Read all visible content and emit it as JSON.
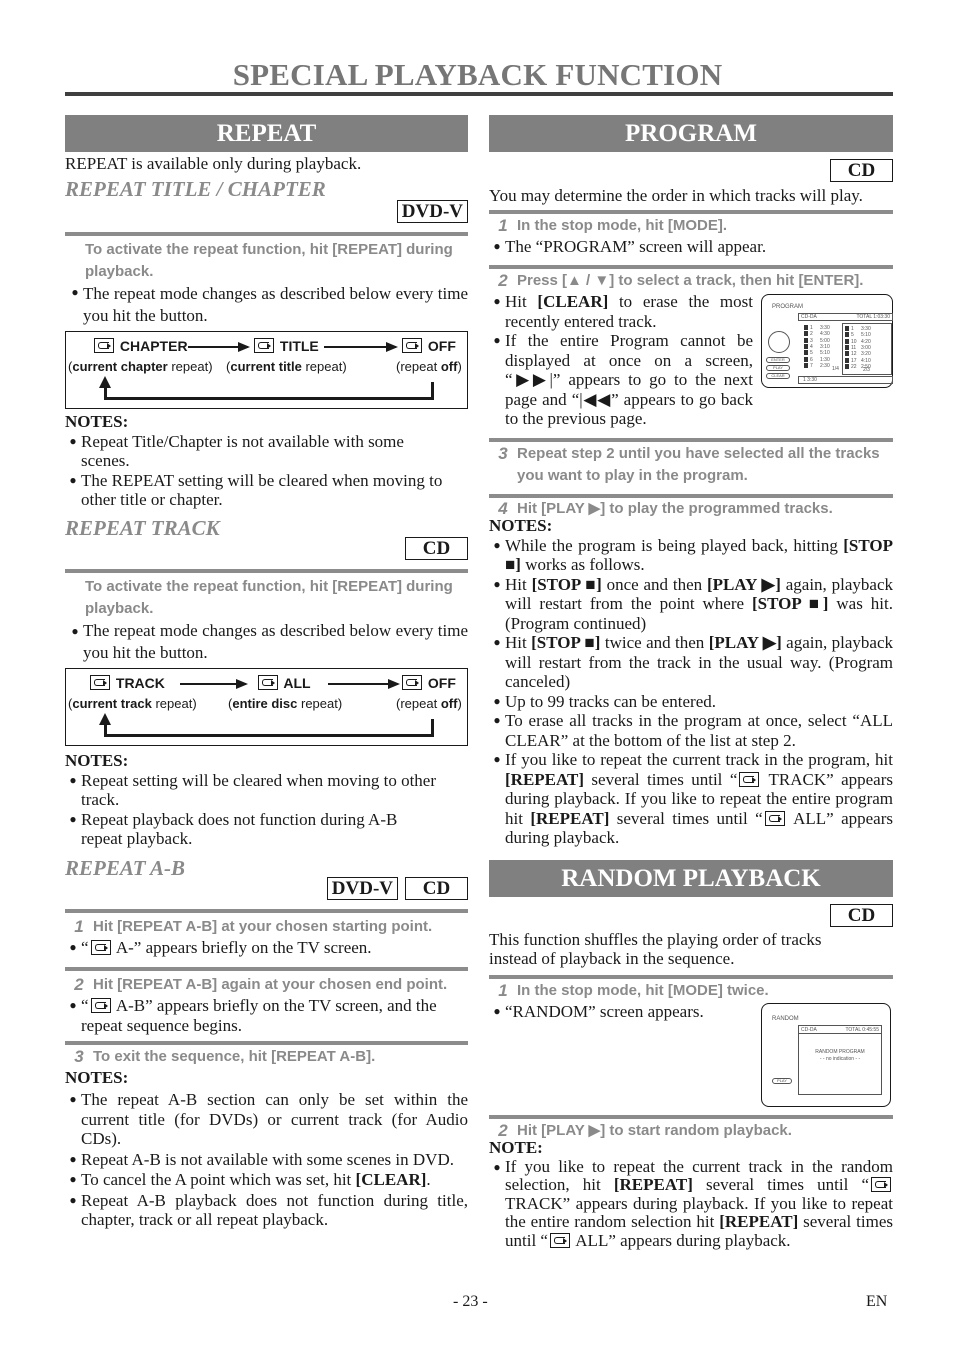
{
  "page": {
    "title": "SPECIAL PLAYBACK FUNCTION",
    "page_number": "- 23 -",
    "language": "EN"
  },
  "repeat": {
    "banner": "REPEAT",
    "intro": "REPEAT is available only during playback.",
    "title_chapter": {
      "heading": "REPEAT TITLE / CHAPTER",
      "tags": [
        "DVD-V"
      ],
      "instruction": "To activate the repeat function, hit [REPEAT] during playback.",
      "bullet": "The repeat mode changes as described below every time you hit the button.",
      "flow": [
        {
          "label": "CHAPTER",
          "caption_bold": "current chapter",
          "caption_rest": " repeat",
          "caption_prefix": ""
        },
        {
          "label": "TITLE",
          "caption_bold": "current title",
          "caption_rest": " repeat",
          "caption_prefix": ""
        },
        {
          "label": "OFF",
          "caption_bold": "off",
          "caption_rest": "",
          "caption_prefix": "repeat "
        }
      ],
      "notes_heading": "NOTES:",
      "notes": [
        "Repeat Title/Chapter is not available with some scenes.",
        "The REPEAT setting will be cleared when moving to other title or chapter."
      ]
    },
    "track": {
      "heading": "REPEAT TRACK",
      "tags": [
        "CD"
      ],
      "instruction": "To activate the repeat function, hit [REPEAT] during playback.",
      "bullet": "The repeat mode changes as described below every time you hit the button.",
      "flow": [
        {
          "label": "TRACK",
          "caption_bold": "current track",
          "caption_rest": " repeat",
          "caption_prefix": ""
        },
        {
          "label": "ALL",
          "caption_bold": "entire disc",
          "caption_rest": " repeat",
          "caption_prefix": ""
        },
        {
          "label": "OFF",
          "caption_bold": "off",
          "caption_rest": "",
          "caption_prefix": "repeat "
        }
      ],
      "notes_heading": "NOTES:",
      "notes": [
        "Repeat setting will be cleared when moving to other track.",
        "Repeat playback does not function during A-B repeat playback."
      ]
    },
    "ab": {
      "heading": "REPEAT A-B",
      "tags": [
        "DVD-V",
        "CD"
      ],
      "steps": [
        {
          "num": "1",
          "text": "Hit [REPEAT A-B] at your chosen starting point.",
          "bullet_pre": "“",
          "bullet_post": " A-” appears briefly on the TV screen."
        },
        {
          "num": "2",
          "text": "Hit [REPEAT A-B] again at your chosen end point.",
          "bullet_pre": "“",
          "bullet_post": " A-B” appears briefly on the TV screen, and the repeat sequence begins."
        },
        {
          "num": "3",
          "text": "To exit the sequence, hit [REPEAT A-B]."
        }
      ],
      "notes_heading": "NOTES:",
      "notes": [
        "The repeat A-B section can only be set within the current title (for DVDs) or current track (for Audio CDs).",
        "Repeat A-B is not available with some scenes in DVD.",
        "To cancel the A point which was set, hit [CLEAR].",
        "Repeat A-B playback does not function during title, chapter, track or all repeat playback."
      ]
    }
  },
  "program": {
    "banner": "PROGRAM",
    "tags": [
      "CD"
    ],
    "intro": "You may determine the order in which tracks will play.",
    "step1": {
      "num": "1",
      "text": "In the stop mode, hit [MODE].",
      "bullet": "The “PROGRAM” screen will appear."
    },
    "step2": {
      "num": "2",
      "text": "Press [▲ / ▼] to select a track, then hit [ENTER].",
      "bullets": [
        "Hit [CLEAR] to erase the most recently entered track.",
        "If the entire Program cannot be displayed at once on a screen, “▶▶|” appears to go to the next page and “|◀◀” appears to go back to the previous page."
      ]
    },
    "screen": {
      "title": "PROGRAM",
      "disc": "CD-DA",
      "total": "TOTAL 1:03:30",
      "left_tracks": [
        {
          "n": "1",
          "t": "3:30"
        },
        {
          "n": "2",
          "t": "4:30"
        },
        {
          "n": "3",
          "t": "5:00"
        },
        {
          "n": "4",
          "t": "3:10"
        },
        {
          "n": "5",
          "t": "5:10"
        },
        {
          "n": "6",
          "t": "1:30"
        },
        {
          "n": "7",
          "t": "2:30"
        }
      ],
      "left_page": "1/4",
      "right_tracks": [
        {
          "n": "1",
          "t": "3:30"
        },
        {
          "n": "5",
          "t": "5:10"
        },
        {
          "n": "10",
          "t": "4:20"
        },
        {
          "n": "11",
          "t": "3:00"
        },
        {
          "n": "12",
          "t": "3:20"
        },
        {
          "n": "17",
          "t": "4:10"
        },
        {
          "n": "22",
          "t": "2:50"
        }
      ],
      "right_page": "2/3",
      "current": "1  3:30",
      "buttons": [
        "ENTER",
        "PLAY",
        "CLEAR"
      ]
    },
    "step3": {
      "num": "3",
      "text": "Repeat step 2 until you have selected all the tracks you want to play in the program."
    },
    "step4": {
      "num": "4",
      "text": "Hit [PLAY ▶] to play the programmed tracks."
    },
    "notes_heading": "NOTES:",
    "notes": [
      "While the program is being played back, hitting [STOP ■] works as follows.",
      "Hit [STOP ■] once and then [PLAY ▶] again, playback will restart from the point where [STOP ■] was hit. (Program continued)",
      "Hit [STOP ■] twice and then [PLAY ▶] again, playback will restart from the track in the usual way. (Program canceled)",
      "Up to 99 tracks can be entered.",
      "To erase all tracks in the program at once, select “ALL CLEAR” at the bottom of the list at step 2.",
      "If you like to repeat the current track in the program, hit [REPEAT] several times until “↻ TRACK” appears during playback. If you like to repeat the entire program hit [REPEAT] several times until “↻ ALL” appears during playback."
    ]
  },
  "random": {
    "banner": "RANDOM PLAYBACK",
    "tags": [
      "CD"
    ],
    "intro": "This function shuffles the playing order of tracks instead of playback in the sequence.",
    "step1": {
      "num": "1",
      "text": "In the stop mode, hit [MODE] twice.",
      "bullet": "“RANDOM” screen appears."
    },
    "screen": {
      "title": "RANDOM",
      "disc": "CD-DA",
      "total": "TOTAL 0:45:55",
      "line1": "RANDOM PROGRAM",
      "line2": "- - no indication - -",
      "button": "PLAY"
    },
    "step2": {
      "num": "2",
      "text": "Hit [PLAY ▶] to start random playback."
    },
    "note_heading": "NOTE:",
    "note": "If you like to repeat the current track in the random selection, hit [REPEAT] several times until “↻ TRACK” appears during playback. If you like to repeat the entire random selection hit [REPEAT] several times until “↻ ALL” appears during playback."
  }
}
